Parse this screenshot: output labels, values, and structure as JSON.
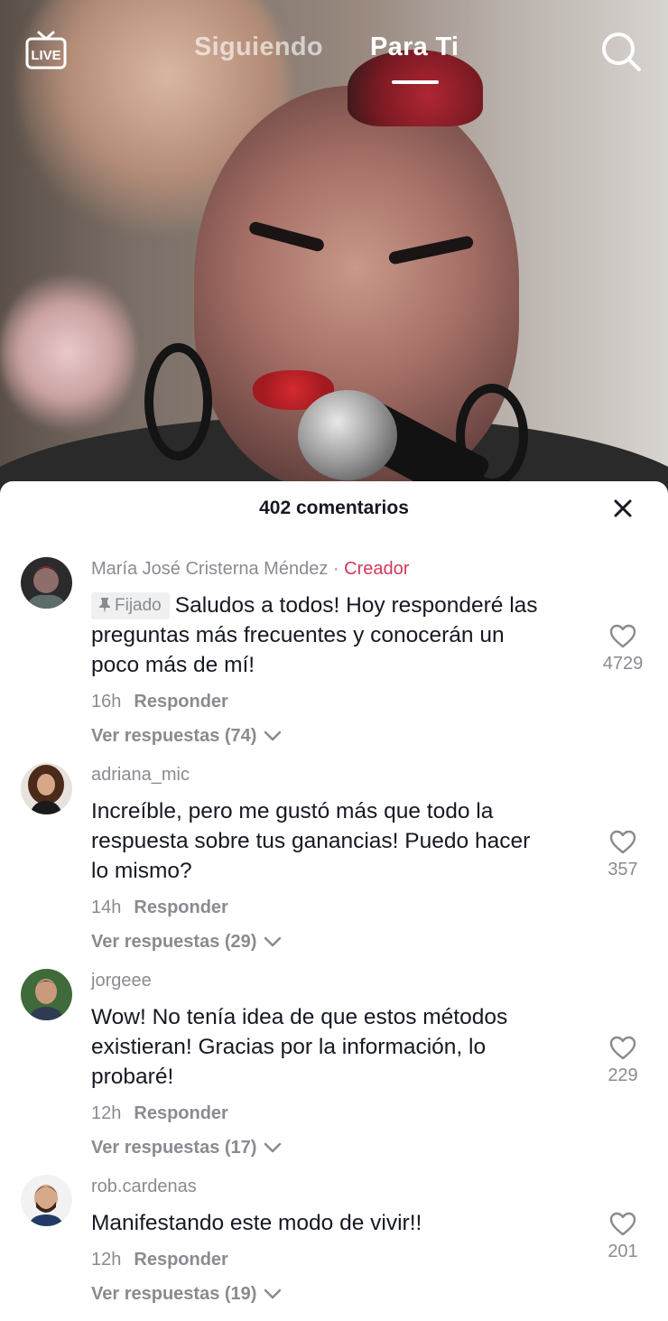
{
  "header": {
    "live_label": "LIVE",
    "tabs": [
      {
        "label": "Siguiendo",
        "active": false
      },
      {
        "label": "Para Ti",
        "active": true
      }
    ]
  },
  "comments_sheet": {
    "title": "402 comentarios",
    "reply_label": "Responder",
    "comments": [
      {
        "username": "María José Cristerna Méndez",
        "badge_separator": "·",
        "badge": "Creador",
        "pinned_label": "Fijado",
        "text": "Saludos a todos! Hoy responderé las preguntas más frecuentes y conocerán un poco más de mí!",
        "time": "16h",
        "view_replies": "Ver respuestas (74)",
        "likes": "4729"
      },
      {
        "username": "adriana_mic",
        "text": "Increíble, pero me gustó más que todo la respuesta sobre tus ganancias! Puedo hacer lo mismo?",
        "time": "14h",
        "view_replies": "Ver respuestas (29)",
        "likes": "357"
      },
      {
        "username": "jorgeee",
        "text": "Wow! No tenía idea de que estos métodos existieran! Gracias por la información, lo probaré!",
        "time": "12h",
        "view_replies": "Ver respuestas (17)",
        "likes": "229"
      },
      {
        "username": "rob.cardenas",
        "text": "Manifestando este modo de vivir!!",
        "time": "12h",
        "view_replies": "Ver respuestas (19)",
        "likes": "201"
      }
    ]
  },
  "colors": {
    "creator_badge": "#d0395a",
    "secondary_text": "#8a8b91",
    "primary_text": "#161823"
  },
  "icons": [
    "live-icon",
    "search-icon",
    "close-icon",
    "pin-icon",
    "heart-icon",
    "chevron-down-icon"
  ]
}
